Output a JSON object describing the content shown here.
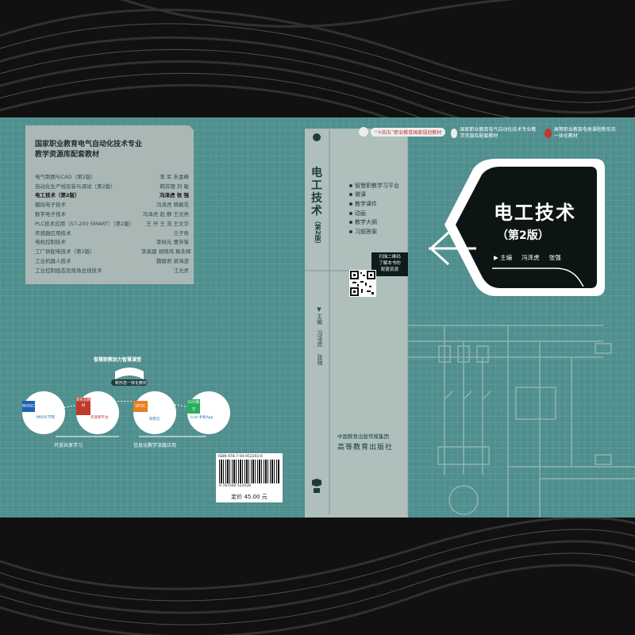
{
  "back_cover": {
    "series_title_line1": "国家职业教育电气自动化技术专业",
    "series_title_line2": "教学资源库配套教材",
    "books": [
      {
        "title": "电气制图与CAD（第2版）",
        "authors": "李 军   朱金峰",
        "highlight": false
      },
      {
        "title": "自动化生产线安装与调试（第2版）",
        "authors": "韩苏丽   刘 敏",
        "highlight": false
      },
      {
        "title": "电工技术（第2版）",
        "authors": "冯泽虎   张 强",
        "highlight": true
      },
      {
        "title": "模拟电子技术",
        "authors": "冯泽虎   韩振花",
        "highlight": false
      },
      {
        "title": "数字电子技术",
        "authors": "冯泽虎  赵 静  王光亮",
        "highlight": false
      },
      {
        "title": "PLC技术应用（S7-200 SMART）（第2版）",
        "authors": "王 开  王 浩  王文华",
        "highlight": false
      },
      {
        "title": "传感器应用技术",
        "authors": "兰子奇",
        "highlight": false
      },
      {
        "title": "电机控制技术",
        "authors": "李树元   曹芳菊",
        "highlight": false
      },
      {
        "title": "工厂供配电技术（第2版）",
        "authors": "李高建  胡晓玮  解永辉",
        "highlight": false
      },
      {
        "title": "工业机器人技术",
        "authors": "魏丽君   梁海波",
        "highlight": false
      },
      {
        "title": "工业控制组态及现场总线技术",
        "authors": "江光灵",
        "highlight": false
      }
    ],
    "diagram": {
      "top_label": "智慧职教助力智慧课堂",
      "sub_label": "新形态一体化教材",
      "circles": [
        "MOOC",
        "新形态教材",
        "SPOC",
        "O2O教学"
      ],
      "circle_notes": [
        "MOOC学院",
        "资源库平台",
        "职教云",
        "icve 手机App"
      ],
      "left_caption": "开放共享学习",
      "right_caption": "信息化教学深度应用"
    },
    "isbn": "ISBN 978-7-04-052203-6",
    "barcode_digits": "9 787040 522036",
    "price": "定价 45.00 元"
  },
  "spine": {
    "title_chars": [
      "电",
      "工",
      "技",
      "术"
    ],
    "edition": "（第2版）",
    "features": [
      "智慧职教学习平台",
      "微课",
      "教学课件",
      "动画",
      "教学大纲",
      "习题答案"
    ],
    "scan_text_lines": [
      "扫描二维码",
      "了解本书的",
      "配套资源"
    ],
    "editor_label": "主编",
    "author1": "冯泽虎",
    "author2": "张强",
    "publisher_group": "中国教育出版传媒集团",
    "publisher": "高等教育出版社"
  },
  "front_cover": {
    "badges": [
      "“十四五”职业教育国家规划教材",
      "国家职业教育电气自动化技术专业教学资源库配套教材",
      "高等职业教育电类课程新形态一体化教材"
    ],
    "title": "电工技术",
    "edition": "（第2版）",
    "editor_prefix": "▶ 主编",
    "author1": "冯泽虎",
    "author2": "张强"
  },
  "colors": {
    "cover_teal": "#4f8f8e",
    "panel_grey": "#a9b8b5",
    "title_black": "#0d1414"
  }
}
